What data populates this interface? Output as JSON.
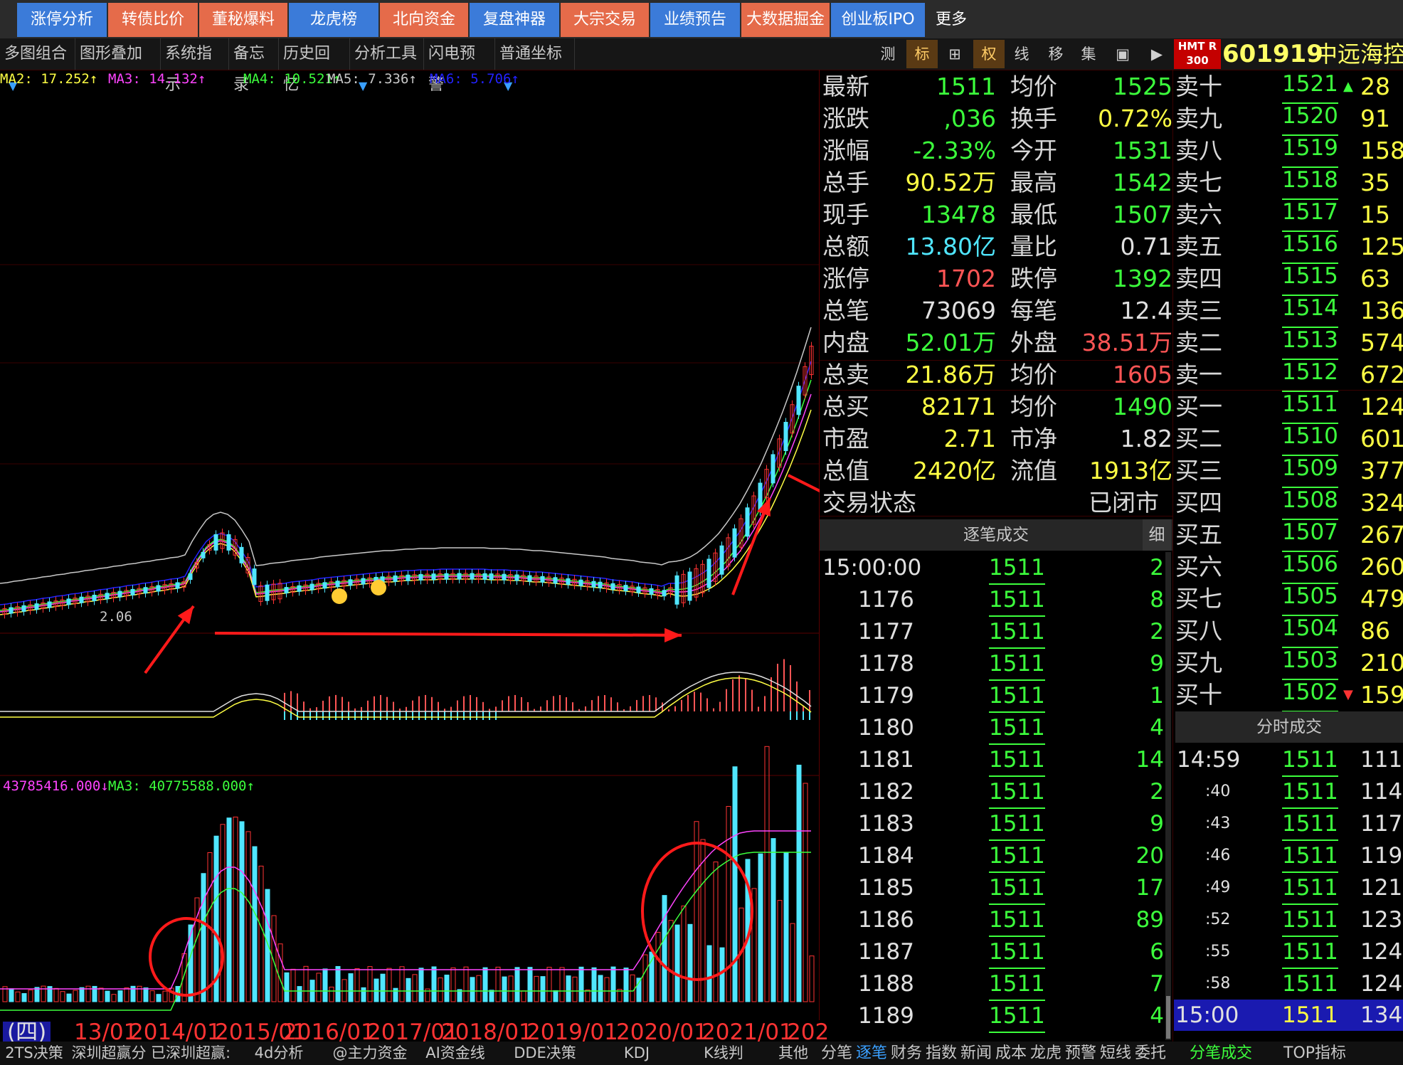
{
  "tabs": [
    {
      "label": "涨停分析",
      "bg": "#3b7bd9"
    },
    {
      "label": "转债比价",
      "bg": "#e56b4a"
    },
    {
      "label": "董秘爆料",
      "bg": "#e56b4a"
    },
    {
      "label": "龙虎榜",
      "bg": "#3b7bd9"
    },
    {
      "label": "北向资金",
      "bg": "#e56b4a"
    },
    {
      "label": "复盘神器",
      "bg": "#3b7bd9"
    },
    {
      "label": "大宗交易",
      "bg": "#e56b4a"
    },
    {
      "label": "业绩预告",
      "bg": "#3b7bd9"
    },
    {
      "label": "大数据掘金",
      "bg": "#e56b4a"
    },
    {
      "label": "创业板IPO",
      "bg": "#3b7bd9"
    },
    {
      "label": "更多",
      "bg": "#2b2b2b"
    }
  ],
  "toolbar": {
    "items": [
      "多图组合",
      "图形叠加",
      "系统指示",
      "备忘录",
      "历史回忆",
      "分析工具",
      "闪电预警",
      "普通坐标"
    ],
    "icons": [
      "测",
      "标",
      "⊞",
      "权",
      "线",
      "移",
      "集",
      "▣",
      "▶"
    ]
  },
  "stock": {
    "badge": "HMT R 300",
    "code": "601919",
    "name": "中远海控"
  },
  "ma_main": [
    {
      "text": "MA2: 17.252↑",
      "color": "#ffff44"
    },
    {
      "text": "MA3: 14.132↑",
      "color": "#ff44ff"
    },
    {
      "text": "MA4: 10.521↑",
      "color": "#3cff3c"
    },
    {
      "text": "MA5: 7.336↑",
      "color": "#c8c8c8"
    },
    {
      "text": "MA6: 5.706↑",
      "color": "#2222ff"
    }
  ],
  "low_label": "2.06",
  "vol_ma": [
    {
      "text": "43785416.000↓",
      "color": "#ff44ff"
    },
    {
      "text": "MA3: 40775588.000↑",
      "color": "#3cff3c"
    }
  ],
  "x_labels": [
    "(四)",
    "13/01",
    "2014/01",
    "2015/01",
    "2016/01",
    "2017/01",
    "2018/01",
    "2019/01",
    "2020/01",
    "2021/01",
    "202"
  ],
  "quote": [
    {
      "l1": "最新",
      "v1": "1511",
      "c1": "green",
      "l2": "均价",
      "v2": "1525",
      "c2": "green"
    },
    {
      "l1": "涨跌",
      "v1": ",036",
      "c1": "green",
      "l2": "换手",
      "v2": "0.72%",
      "c2": "yellow"
    },
    {
      "l1": "涨幅",
      "v1": "-2.33%",
      "c1": "green",
      "l2": "今开",
      "v2": "1531",
      "c2": "green"
    },
    {
      "l1": "总手",
      "v1": "90.52万",
      "c1": "yellow",
      "l2": "最高",
      "v2": "1542",
      "c2": "green"
    },
    {
      "l1": "现手",
      "v1": "13478",
      "c1": "green",
      "l2": "最低",
      "v2": "1507",
      "c2": "green"
    },
    {
      "l1": "总额",
      "v1": "13.80亿",
      "c1": "cyan",
      "l2": "量比",
      "v2": "0.71",
      "c2": "white"
    },
    {
      "l1": "涨停",
      "v1": "1702",
      "c1": "red",
      "l2": "跌停",
      "v2": "1392",
      "c2": "green"
    },
    {
      "l1": "总笔",
      "v1": "73069",
      "c1": "white",
      "l2": "每笔",
      "v2": "12.4",
      "c2": "white"
    },
    {
      "l1": "内盘",
      "v1": "52.01万",
      "c1": "green",
      "l2": "外盘",
      "v2": "38.51万",
      "c2": "red"
    },
    {
      "l1": "总卖",
      "v1": "21.86万",
      "c1": "yellow",
      "l2": "均价",
      "v2": "1605",
      "c2": "red"
    },
    {
      "l1": "总买",
      "v1": "82171",
      "c1": "yellow",
      "l2": "均价",
      "v2": "1490",
      "c2": "green"
    },
    {
      "l1": "市盈",
      "v1": "2.71",
      "c1": "yellow",
      "l2": "市净",
      "v2": "1.82",
      "c2": "white"
    },
    {
      "l1": "总值",
      "v1": "2420亿",
      "c1": "yellow",
      "l2": "流值",
      "v2": "1913亿",
      "c2": "yellow"
    }
  ],
  "trade_status": {
    "label": "交易状态",
    "value": "已闭市"
  },
  "ticks_header": "逐笔成交",
  "ticks_header_btn": "细",
  "ticks": [
    {
      "t": "15:00:00",
      "p": "1511",
      "v": "2"
    },
    {
      "t": "1176",
      "p": "1511",
      "v": "8"
    },
    {
      "t": "1177",
      "p": "1511",
      "v": "2"
    },
    {
      "t": "1178",
      "p": "1511",
      "v": "9"
    },
    {
      "t": "1179",
      "p": "1511",
      "v": "1"
    },
    {
      "t": "1180",
      "p": "1511",
      "v": "4"
    },
    {
      "t": "1181",
      "p": "1511",
      "v": "14"
    },
    {
      "t": "1182",
      "p": "1511",
      "v": "2"
    },
    {
      "t": "1183",
      "p": "1511",
      "v": "9"
    },
    {
      "t": "1184",
      "p": "1511",
      "v": "20"
    },
    {
      "t": "1185",
      "p": "1511",
      "v": "17"
    },
    {
      "t": "1186",
      "p": "1511",
      "v": "89"
    },
    {
      "t": "1187",
      "p": "1511",
      "v": "6"
    },
    {
      "t": "1188",
      "p": "1511",
      "v": "7"
    },
    {
      "t": "1189",
      "p": "1511",
      "v": "4"
    }
  ],
  "orderbook": [
    {
      "l": "卖十",
      "p": "1521",
      "v": "28",
      "mark": "▲"
    },
    {
      "l": "卖九",
      "p": "1520",
      "v": "91",
      "mark": ""
    },
    {
      "l": "卖八",
      "p": "1519",
      "v": "158",
      "mark": ""
    },
    {
      "l": "卖七",
      "p": "1518",
      "v": "35",
      "mark": ""
    },
    {
      "l": "卖六",
      "p": "1517",
      "v": "15",
      "mark": ""
    },
    {
      "l": "卖五",
      "p": "1516",
      "v": "125",
      "mark": ""
    },
    {
      "l": "卖四",
      "p": "1515",
      "v": "63",
      "mark": ""
    },
    {
      "l": "卖三",
      "p": "1514",
      "v": "136",
      "mark": ""
    },
    {
      "l": "卖二",
      "p": "1513",
      "v": "574",
      "mark": ""
    },
    {
      "l": "卖一",
      "p": "1512",
      "v": "672",
      "mark": ""
    },
    {
      "l": "买一",
      "p": "1511",
      "v": "124",
      "mark": ""
    },
    {
      "l": "买二",
      "p": "1510",
      "v": "601",
      "mark": ""
    },
    {
      "l": "买三",
      "p": "1509",
      "v": "377",
      "mark": ""
    },
    {
      "l": "买四",
      "p": "1508",
      "v": "324",
      "mark": ""
    },
    {
      "l": "买五",
      "p": "1507",
      "v": "267",
      "mark": ""
    },
    {
      "l": "买六",
      "p": "1506",
      "v": "260",
      "mark": ""
    },
    {
      "l": "买七",
      "p": "1505",
      "v": "479",
      "mark": ""
    },
    {
      "l": "买八",
      "p": "1504",
      "v": "86",
      "mark": ""
    },
    {
      "l": "买九",
      "p": "1503",
      "v": "210",
      "mark": ""
    },
    {
      "l": "买十",
      "p": "1502",
      "v": "159",
      "mark": "▼"
    }
  ],
  "min_header": "分时成交",
  "minute": [
    {
      "t": "14:59",
      "p": "1511",
      "v": "111"
    },
    {
      "t": ":40",
      "p": "1511",
      "v": "114"
    },
    {
      "t": ":43",
      "p": "1511",
      "v": "117"
    },
    {
      "t": ":46",
      "p": "1511",
      "v": "119"
    },
    {
      "t": ":49",
      "p": "1511",
      "v": "121"
    },
    {
      "t": ":52",
      "p": "1511",
      "v": "123"
    },
    {
      "t": ":55",
      "p": "1511",
      "v": "124"
    },
    {
      "t": ":58",
      "p": "1511",
      "v": "124"
    }
  ],
  "minute_last": {
    "t": "15:00",
    "p": "1511",
    "v": "134"
  },
  "bottom_left": [
    "2TS决策",
    "深圳超赢分",
    "已深圳超赢:",
    "4d分析",
    "@主力资金",
    "AI资金线",
    "DDE决策",
    "KDJ",
    "K线判",
    "其他"
  ],
  "bottom_mid": [
    "分笔",
    "逐笔",
    "财务",
    "指数",
    "新闻",
    "成本",
    "龙虎",
    "预警",
    "短线",
    "委托"
  ],
  "bottom_right": [
    "分笔成交",
    "TOP指标"
  ]
}
